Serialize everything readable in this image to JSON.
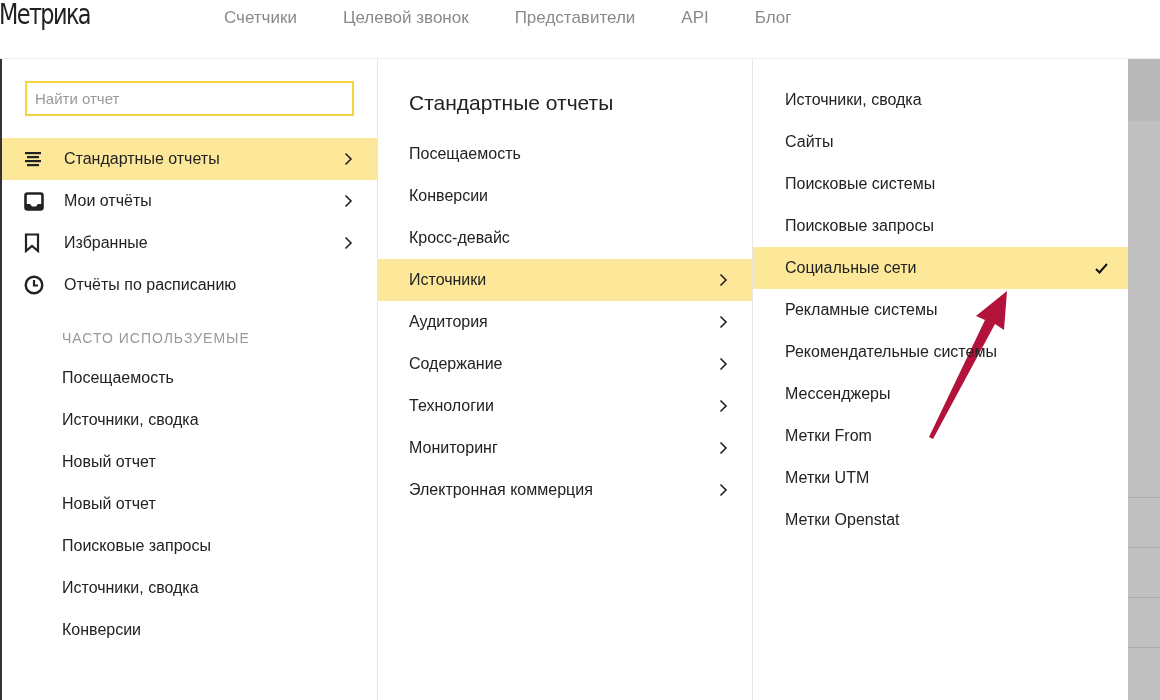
{
  "header": {
    "logo": "Метрика",
    "nav": [
      "Счетчики",
      "Целевой звонок",
      "Представители",
      "API",
      "Блог"
    ]
  },
  "search": {
    "placeholder": "Найти отчет"
  },
  "sidebar": {
    "items": [
      {
        "kind": "list",
        "label": "Стандартные отчеты",
        "selected": true,
        "has_submenu": true
      },
      {
        "kind": "inbox",
        "label": "Мои отчёты",
        "selected": false,
        "has_submenu": true
      },
      {
        "kind": "bookmark",
        "label": "Избранные",
        "selected": false,
        "has_submenu": true
      },
      {
        "kind": "clock",
        "label": "Отчёты по расписанию",
        "selected": false,
        "has_submenu": false
      }
    ],
    "frequent": {
      "heading": "ЧАСТО ИСПОЛЬЗУЕМЫЕ",
      "items": [
        "Посещаемость",
        "Источники, сводка",
        "Новый отчет",
        "Новый отчет",
        "Поисковые запросы",
        "Источники, сводка",
        "Конверсии"
      ]
    }
  },
  "categories": {
    "title": "Стандартные отчеты",
    "items": [
      {
        "label": "Посещаемость",
        "selected": false,
        "has_submenu": false
      },
      {
        "label": "Конверсии",
        "selected": false,
        "has_submenu": false
      },
      {
        "label": "Кросс-девайс",
        "selected": false,
        "has_submenu": false
      },
      {
        "label": "Источники",
        "selected": true,
        "has_submenu": true
      },
      {
        "label": "Аудитория",
        "selected": false,
        "has_submenu": true
      },
      {
        "label": "Содержание",
        "selected": false,
        "has_submenu": true
      },
      {
        "label": "Технологии",
        "selected": false,
        "has_submenu": true
      },
      {
        "label": "Мониторинг",
        "selected": false,
        "has_submenu": true
      },
      {
        "label": "Электронная коммерция",
        "selected": false,
        "has_submenu": true
      }
    ]
  },
  "reports": {
    "items": [
      {
        "label": "Источники, сводка",
        "selected": false
      },
      {
        "label": "Сайты",
        "selected": false
      },
      {
        "label": "Поисковые системы",
        "selected": false
      },
      {
        "label": "Поисковые запросы",
        "selected": false
      },
      {
        "label": "Социальные сети",
        "selected": true
      },
      {
        "label": "Рекламные системы",
        "selected": false
      },
      {
        "label": "Рекомендательные системы",
        "selected": false
      },
      {
        "label": "Мессенджеры",
        "selected": false
      },
      {
        "label": "Метки From",
        "selected": false
      },
      {
        "label": "Метки UTM",
        "selected": false
      },
      {
        "label": "Метки Openstat",
        "selected": false
      }
    ]
  }
}
